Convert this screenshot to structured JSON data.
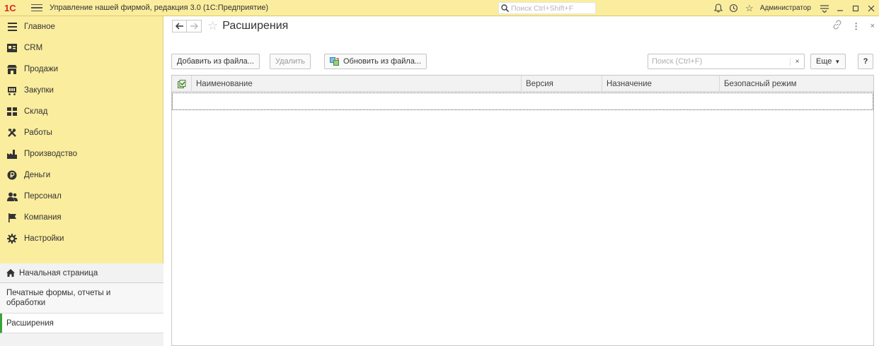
{
  "titlebar": {
    "logo_text": "1С",
    "app_title": "Управление нашей фирмой, редакция 3.0  (1С:Предприятие)",
    "search_placeholder": "Поиск Ctrl+Shift+F",
    "user": "Администратор",
    "icons": [
      "bell-icon",
      "history-icon",
      "favorites-star-icon",
      "settings-menu-icon",
      "minimize-icon",
      "maximize-icon",
      "close-icon"
    ]
  },
  "sidebar": {
    "items": [
      {
        "label": "Главное",
        "icon": "menu-lines-icon"
      },
      {
        "label": "CRM",
        "icon": "crm-icon"
      },
      {
        "label": "Продажи",
        "icon": "shop-icon"
      },
      {
        "label": "Закупки",
        "icon": "cart-icon"
      },
      {
        "label": "Склад",
        "icon": "warehouse-icon"
      },
      {
        "label": "Работы",
        "icon": "tools-icon"
      },
      {
        "label": "Производство",
        "icon": "factory-icon"
      },
      {
        "label": "Деньги",
        "icon": "money-icon"
      },
      {
        "label": "Персонал",
        "icon": "people-icon"
      },
      {
        "label": "Компания",
        "icon": "flag-icon"
      },
      {
        "label": "Настройки",
        "icon": "gear-icon"
      }
    ],
    "home": "Начальная страница",
    "print_forms": "Печатные формы, отчеты и обработки",
    "extensions": "Расширения"
  },
  "main": {
    "title": "Расширения",
    "toolbar": {
      "add_from_file": "Добавить из файла...",
      "delete": "Удалить",
      "update_from_file": "Обновить из файла...",
      "search_placeholder": "Поиск (Ctrl+F)",
      "clear": "×",
      "more": "Еще",
      "help": "?"
    },
    "table": {
      "columns": [
        "Наименование",
        "Версия",
        "Назначение",
        "Безопасный режим"
      ],
      "rows": []
    }
  },
  "colors": {
    "sidebar_bg": "#fbed9e",
    "logo_red": "#d3281f",
    "active_marker": "#39a339"
  }
}
